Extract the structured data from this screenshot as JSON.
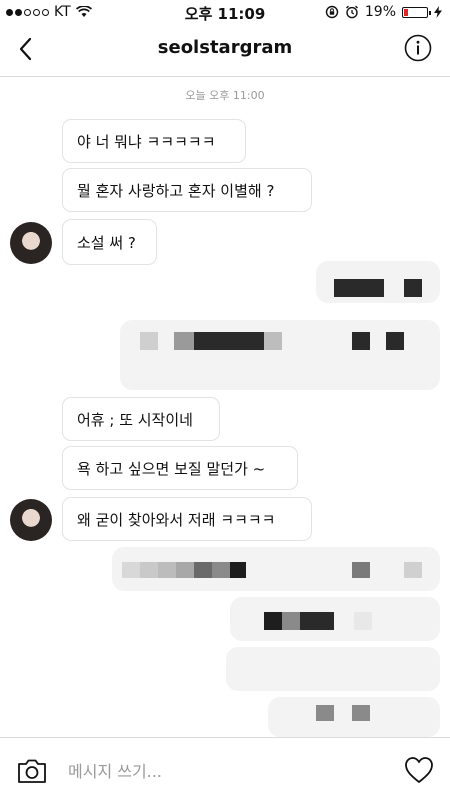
{
  "status_bar": {
    "carrier": "KT",
    "time": "오후 11:09",
    "battery_percent": "19%",
    "battery_level": 0.19
  },
  "header": {
    "title": "seolstargram",
    "back_icon": "chevron-left-icon",
    "info_icon": "info-circle-icon"
  },
  "chat": {
    "timestamp": "오늘 오후 11:00",
    "received_messages": [
      "야 너 뭐냐 ㅋㅋㅋㅋㅋ",
      "뭘 혼자 사랑하고 혼자 이별해 ?",
      "소설 써 ?",
      "어휴 ; 또 시작이네",
      "욕 하고 싶으면 보질 말던가 ~",
      "왜 굳이 찾아와서 저래 ㅋㅋㅋㅋ"
    ],
    "sent_messages_note": "pixelated"
  },
  "composer": {
    "placeholder": "메시지 쓰기...",
    "camera_icon": "camera-icon",
    "heart_icon": "heart-icon"
  },
  "colors": {
    "accent": "#111111",
    "border": "#dbdbdb",
    "battery_low": "#e02424",
    "timestamp": "#9a9a9a"
  }
}
